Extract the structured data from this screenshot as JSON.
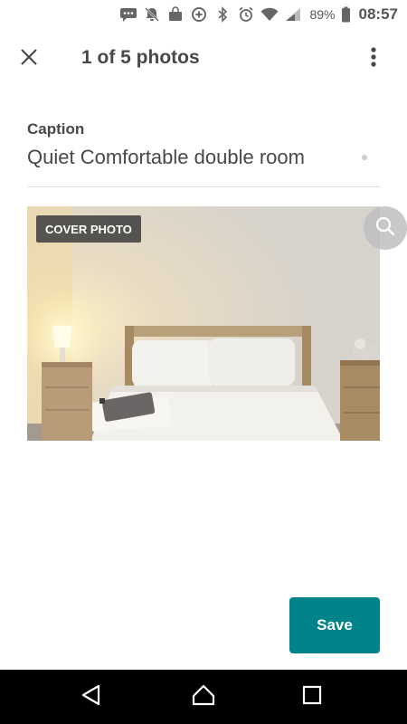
{
  "status_bar": {
    "icons": [
      "message-icon",
      "notifications-off-icon",
      "shopping-bag-icon",
      "data-saver-icon",
      "bluetooth-icon",
      "alarm-icon",
      "wifi-icon",
      "signal-icon",
      "battery-icon"
    ],
    "battery": "89%",
    "time": "08:57"
  },
  "header": {
    "close_icon": "close-icon",
    "title": "1 of 5 photos",
    "more_icon": "more-vert-icon"
  },
  "caption": {
    "label": "Caption",
    "value": "Quiet Comfortable double room"
  },
  "photo": {
    "badge": "COVER PHOTO",
    "zoom_icon": "search-icon",
    "description_icon": "bedroom-photo"
  },
  "actions": {
    "save_label": "Save"
  },
  "colors": {
    "accent": "#008489",
    "text": "#484848",
    "divider": "#dddddd",
    "navbar": "#000000"
  },
  "nav_bar": {
    "icons": [
      "back-icon",
      "home-icon",
      "recents-icon"
    ]
  }
}
